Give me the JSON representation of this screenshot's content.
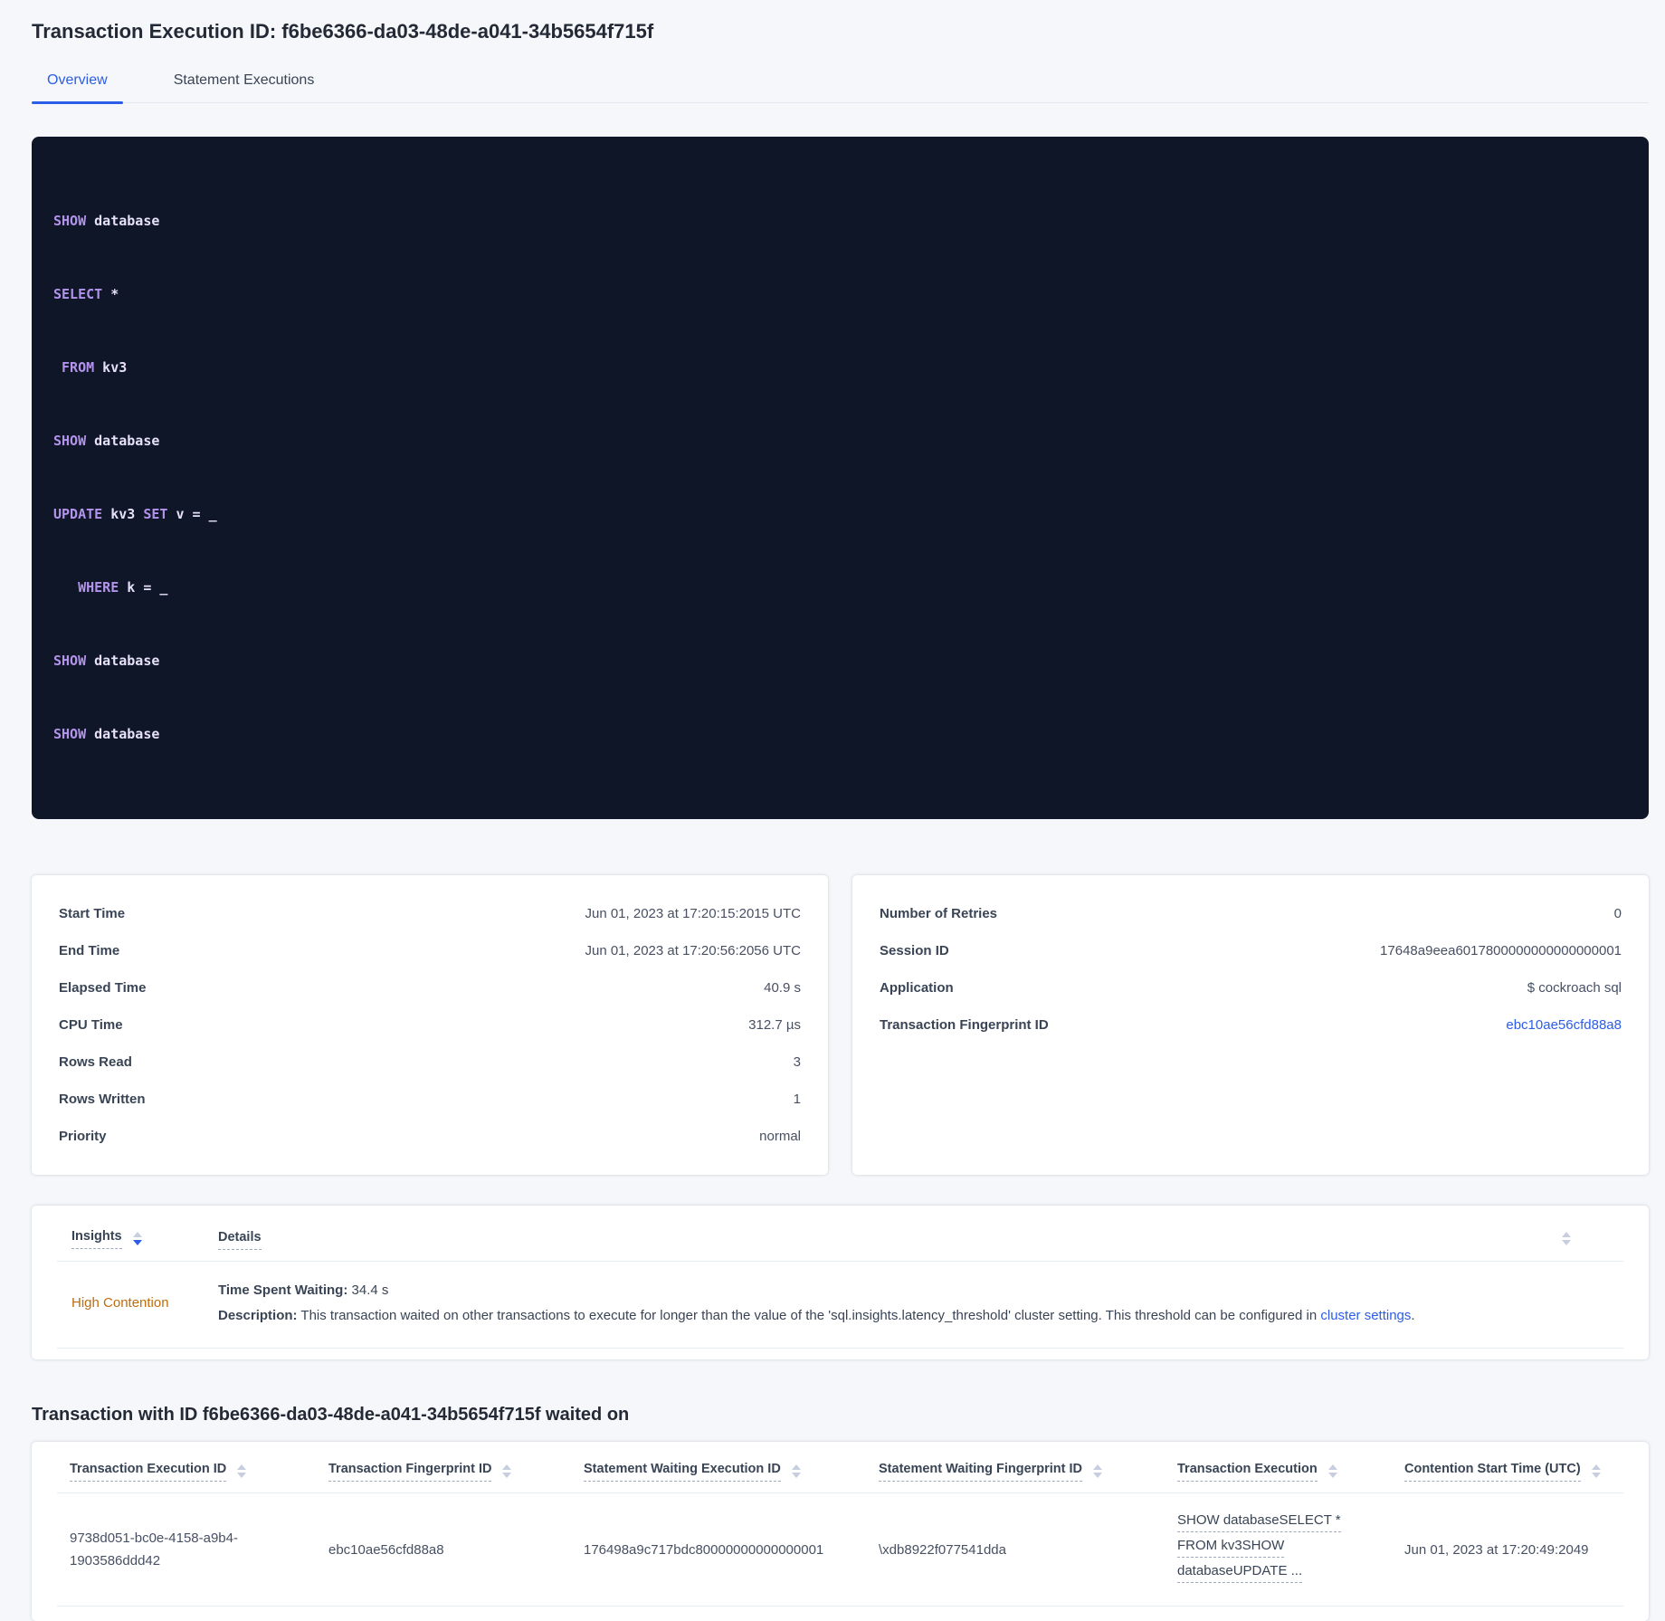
{
  "colors": {
    "accent_blue": "#2b5de8",
    "warning_orange": "#bf6c0c",
    "code_background": "#0e1628",
    "code_keyword_purple": "#b493ec",
    "page_background": "#f5f7fa"
  },
  "icons": {
    "sort": "sort-arrows-icon"
  },
  "page": {
    "title": "Transaction Execution ID: f6be6366-da03-48de-a041-34b5654f715f",
    "tabs": [
      {
        "label": "Overview",
        "active": true
      },
      {
        "label": "Statement Executions",
        "active": false
      }
    ]
  },
  "sql": {
    "l1": {
      "kw": "SHOW",
      "rest": " database"
    },
    "l2": {
      "kw": "SELECT",
      "rest": " *"
    },
    "l3": {
      "ind": " ",
      "kw": "FROM",
      "rest": " kv3"
    },
    "l4": {
      "kw": "SHOW",
      "rest": " database"
    },
    "l5": {
      "kw1": "UPDATE",
      "t1": " kv3 ",
      "kw2": "SET",
      "t2": " v = _"
    },
    "l6": {
      "ind": "   ",
      "kw": "WHERE",
      "rest": " k = _"
    },
    "l7": {
      "kw": "SHOW",
      "rest": " database"
    },
    "l8": {
      "kw": "SHOW",
      "rest": " database"
    }
  },
  "left_card": {
    "rows": [
      {
        "label": "Start Time",
        "value": "Jun 01, 2023 at 17:20:15:2015 UTC"
      },
      {
        "label": "End Time",
        "value": "Jun 01, 2023 at 17:20:56:2056 UTC"
      },
      {
        "label": "Elapsed Time",
        "value": "40.9 s"
      },
      {
        "label": "CPU Time",
        "value": "312.7 µs"
      },
      {
        "label": "Rows Read",
        "value": "3"
      },
      {
        "label": "Rows Written",
        "value": "1"
      },
      {
        "label": "Priority",
        "value": "normal"
      }
    ]
  },
  "right_card": {
    "rows": [
      {
        "label": "Number of Retries",
        "value": "0"
      },
      {
        "label": "Session ID",
        "value": "17648a9eea6017800000000000000001"
      },
      {
        "label": "Application",
        "value": "$ cockroach sql"
      },
      {
        "label": "Transaction Fingerprint ID",
        "value": "ebc10ae56cfd88a8"
      }
    ]
  },
  "insights": {
    "col_insights": "Insights",
    "col_details": "Details",
    "row": {
      "insight": "High Contention",
      "waiting_label": "Time Spent Waiting:",
      "waiting_value": " 34.4 s",
      "desc_label": "Description:",
      "desc_text": " This transaction waited on other transactions to execute for longer than the value of the 'sql.insights.latency_threshold' cluster setting. This threshold can be configured in ",
      "desc_link": "cluster settings",
      "desc_suffix": "."
    }
  },
  "waited_on": {
    "heading": "Transaction with ID f6be6366-da03-48de-a041-34b5654f715f waited on",
    "columns": [
      "Transaction Execution ID",
      "Transaction Fingerprint ID",
      "Statement Waiting Execution ID",
      "Statement Waiting Fingerprint ID",
      "Transaction Execution",
      "Contention Start Time (UTC)"
    ],
    "row": {
      "txn_execution_id": "9738d051-bc0e-4158-a9b4-1903586ddd42",
      "txn_fingerprint_id": "ebc10ae56cfd88a8",
      "stmt_waiting_execution_id": "176498a9c717bdc80000000000000001",
      "stmt_waiting_fingerprint_id": "\\xdb8922f077541dda",
      "txn_execution_lines": [
        "SHOW databaseSELECT *",
        "FROM kv3SHOW",
        "databaseUPDATE ..."
      ],
      "contention_start": "Jun 01, 2023 at 17:20:49:2049"
    }
  }
}
